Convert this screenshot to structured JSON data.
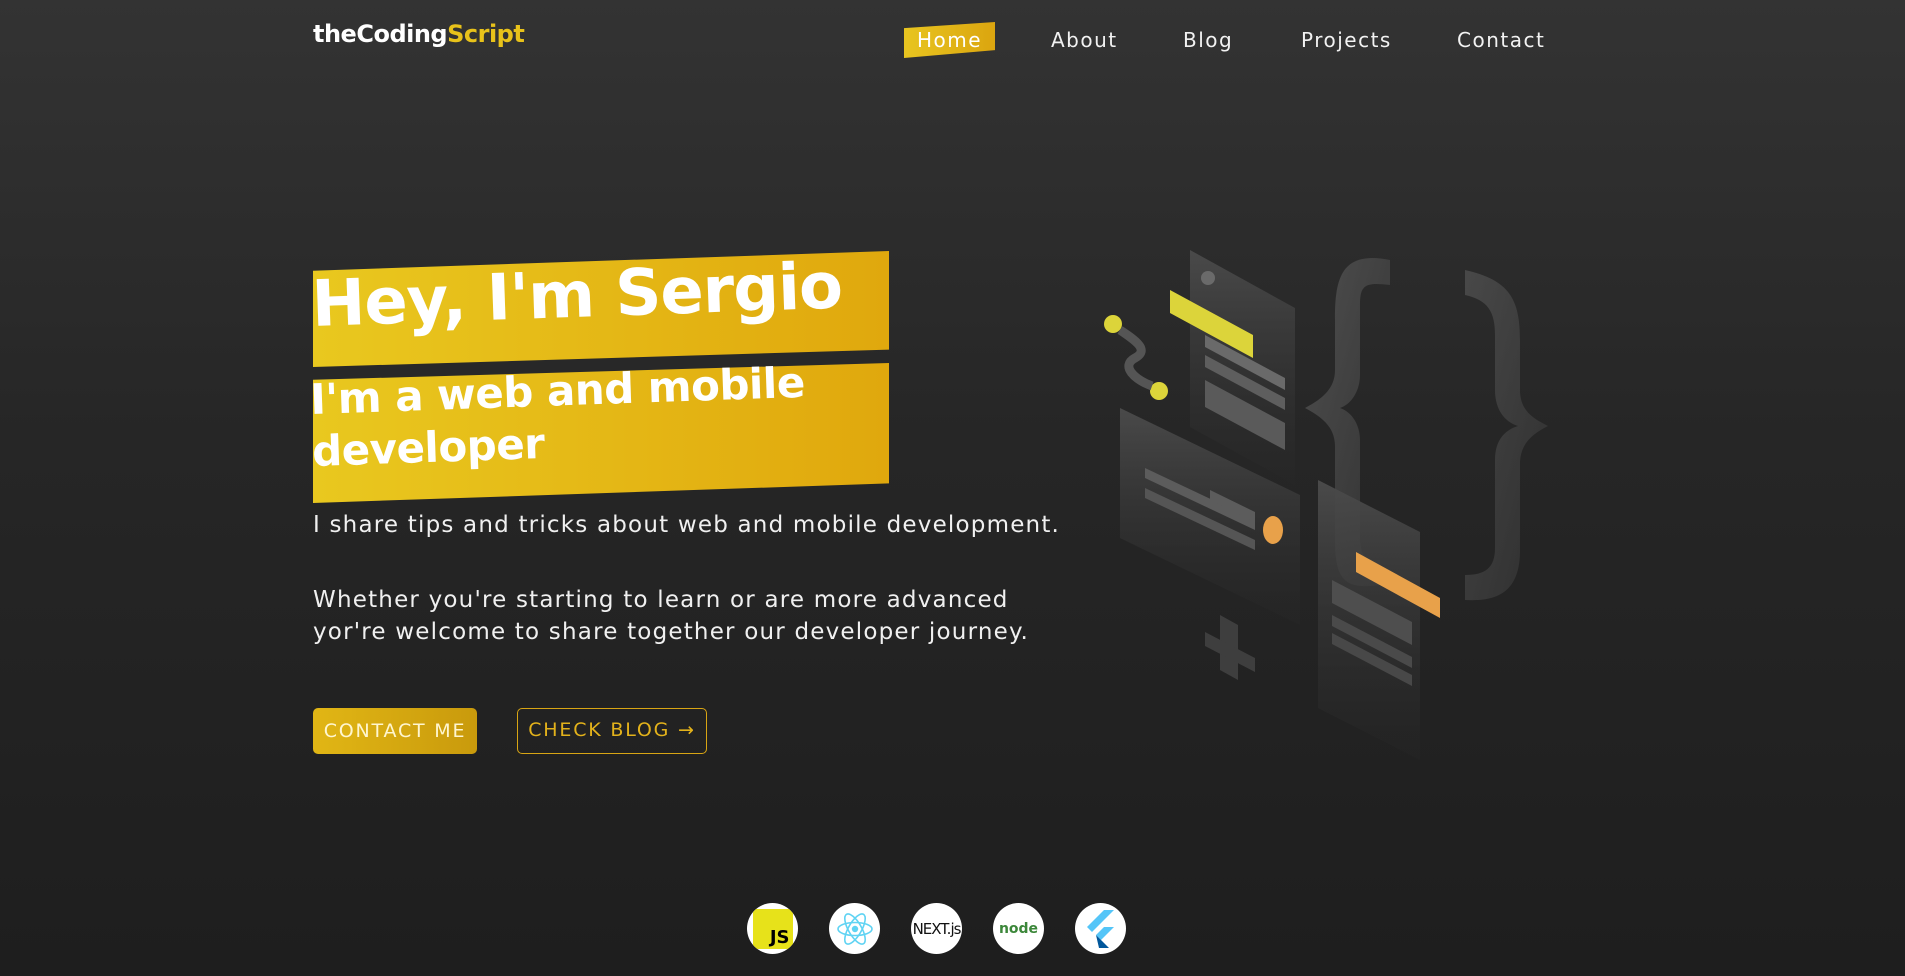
{
  "brand": {
    "prefix": "theCoding",
    "accent": "Script",
    "accent_color": "#e8c21a"
  },
  "nav": {
    "active": "Home",
    "items": [
      "Home",
      "About",
      "Blog",
      "Projects",
      "Contact"
    ]
  },
  "hero": {
    "title": "Hey, I'm Sergio",
    "subtitle": "I'm a web and mobile developer",
    "tagline": "I share tips and tricks about web and mobile development.",
    "intro": "Whether you're starting to learn or are more advanced yor're welcome to share together our developer journey.",
    "banner_colors": [
      "#e9c81f",
      "#e0a80d"
    ]
  },
  "actions": {
    "contact_label": "CONTACT ME",
    "blog_label": "CHECK BLOG →"
  },
  "tech_stack": [
    {
      "name": "javascript-icon",
      "label": "JS"
    },
    {
      "name": "react-icon",
      "label": ""
    },
    {
      "name": "nextjs-icon",
      "label": "NEXT.js"
    },
    {
      "name": "nodejs-icon",
      "label": "node"
    },
    {
      "name": "flutter-icon",
      "label": ""
    }
  ],
  "colors": {
    "background": "#2a2a2a",
    "accent": "#e3b21b"
  }
}
